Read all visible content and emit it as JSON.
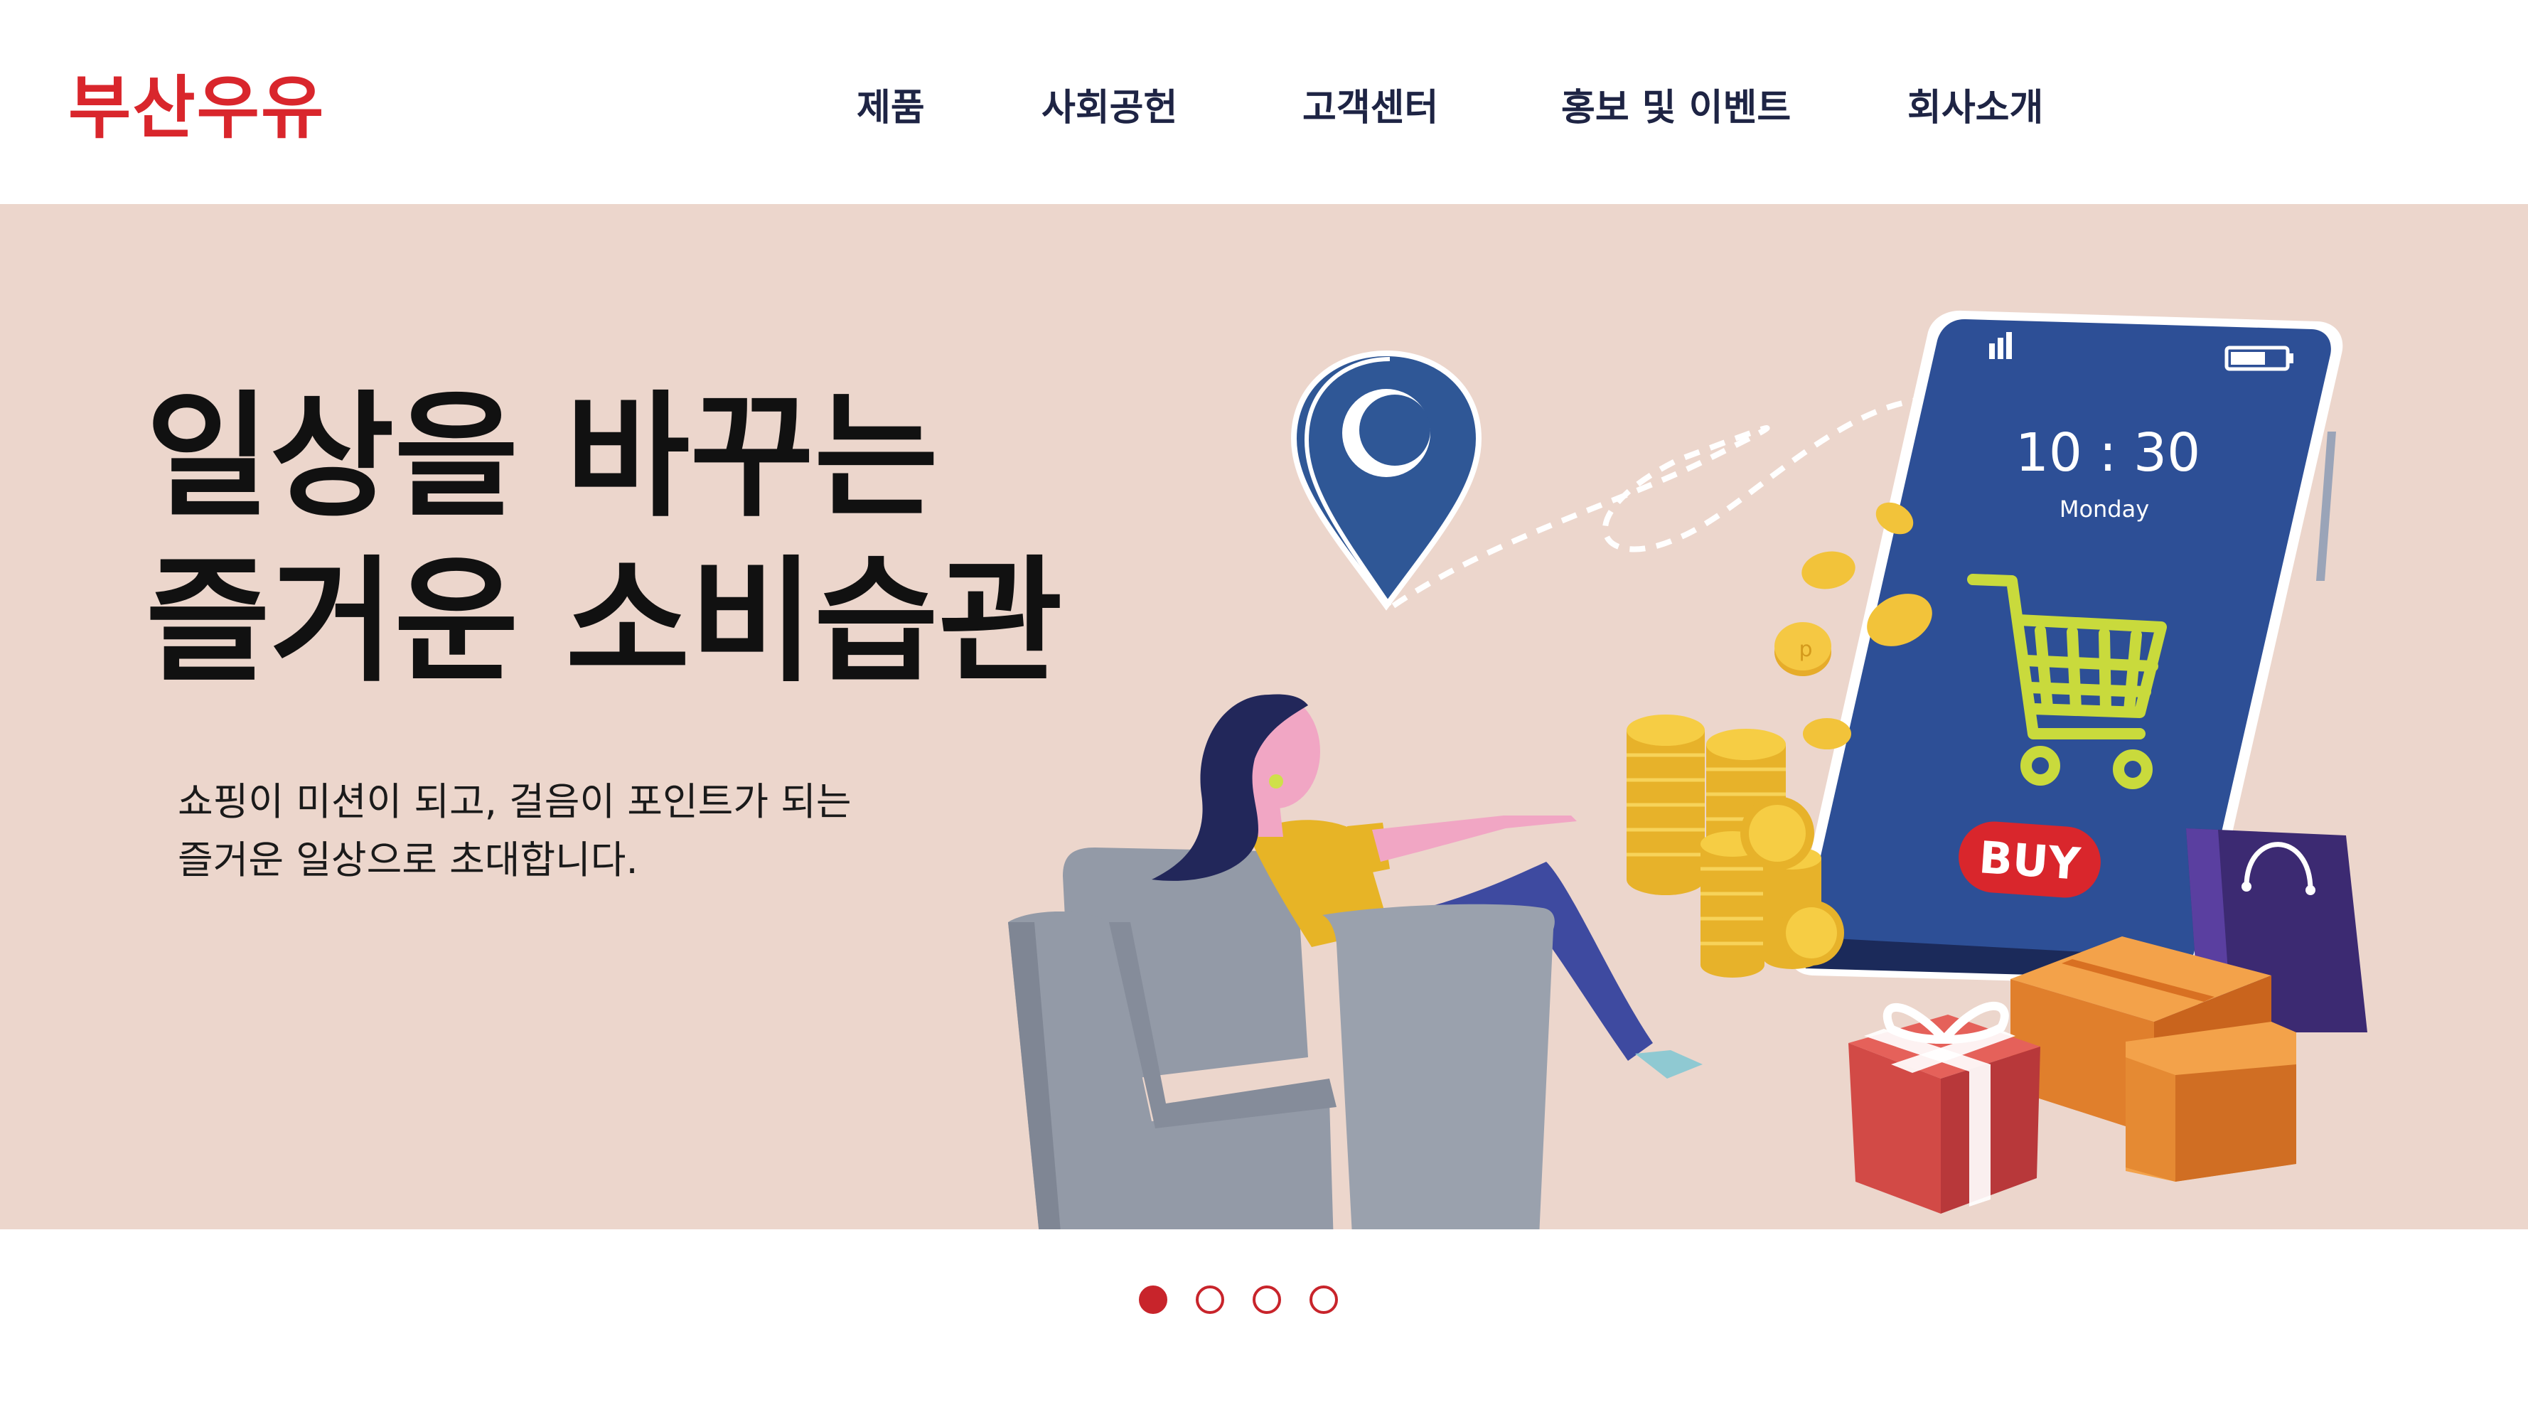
{
  "header": {
    "logo_text": "부산우유",
    "nav": [
      {
        "label": "제품"
      },
      {
        "label": "사회공헌"
      },
      {
        "label": "고객센터"
      },
      {
        "label": "홍보 및 이벤트"
      },
      {
        "label": "회사소개"
      }
    ]
  },
  "hero": {
    "headline_line1": "일상을 바꾸는",
    "headline_line2": "즐거운 소비습관",
    "sub_line1": "쇼핑이 미션이 되고, 걸음이 포인트가 되는",
    "sub_line2": "즐거운 일상으로 초대합니다.",
    "phone": {
      "time": "10 : 30",
      "day": "Monday",
      "buy_label": "BUY"
    },
    "coin_mark": "p"
  },
  "carousel": {
    "total": 4,
    "active_index": 0
  },
  "colors": {
    "brand_red": "#d9262c",
    "hero_bg": "#ecd6cc",
    "nav_text": "#1e2444",
    "phone_screen": "#2d4f96"
  }
}
